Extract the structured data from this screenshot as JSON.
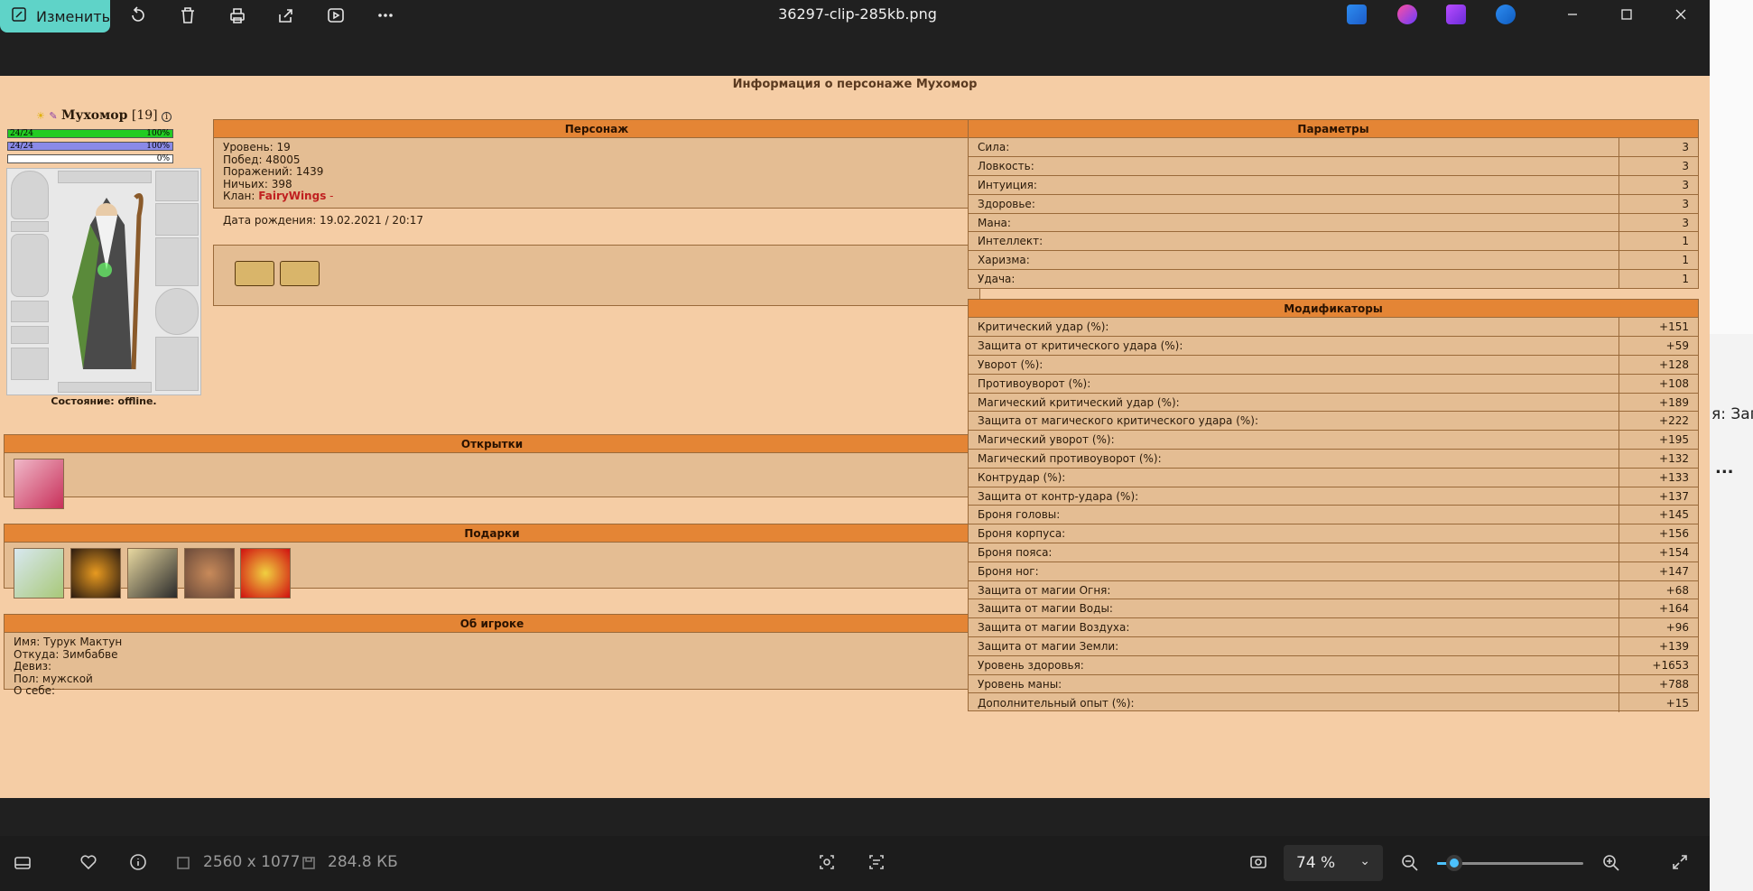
{
  "window": {
    "edit_label": "Изменить",
    "filename": "36297-clip-285kb.png"
  },
  "side": {
    "partial_text": "я: Загр",
    "dots": "..."
  },
  "page": {
    "title": "Информация о персонаже Мухомор",
    "character": {
      "name": "Мухомор",
      "level_tag": "[19]",
      "hp_bar": {
        "left": "24/24",
        "right": "100%",
        "fraction": 1.0,
        "color": "#22cc22"
      },
      "mana_bar": {
        "left": "24/24",
        "right": "100%",
        "fraction": 1.0,
        "color": "#8a8ae8"
      },
      "exp_bar": {
        "right": "0%",
        "fraction": 0.0
      },
      "status": "Состояние: offline."
    },
    "personage": {
      "header": "Персонаж",
      "level": "Уровень: 19",
      "wins": "Побед: 48005",
      "losses": "Поражений: 1439",
      "draws": "Ничьих: 398",
      "clan_label": "Клан:",
      "clan_name": "FairyWings",
      "clan_suffix": "-",
      "birth": "Дата рождения: 19.02.2021 / 20:17"
    },
    "cards": {
      "header": "Открытки"
    },
    "gifts": {
      "header": "Подарки"
    },
    "about": {
      "header": "Об игроке",
      "lines": [
        "Имя: Турук Мактун",
        "Откуда: Зимбабве",
        "Девиз:",
        "Пол: мужской",
        "О себе:"
      ]
    },
    "params": {
      "header": "Параметры",
      "rows": [
        [
          "Сила:",
          "3"
        ],
        [
          "Ловкость:",
          "3"
        ],
        [
          "Интуиция:",
          "3"
        ],
        [
          "Здоровье:",
          "3"
        ],
        [
          "Мана:",
          "3"
        ],
        [
          "Интеллект:",
          "1"
        ],
        [
          "Харизма:",
          "1"
        ],
        [
          "Удача:",
          "1"
        ]
      ]
    },
    "modifiers": {
      "header": "Модификаторы",
      "rows": [
        [
          "Критический удар (%):",
          "+151"
        ],
        [
          "Защита от критического удара (%):",
          "+59"
        ],
        [
          "Уворот (%):",
          "+128"
        ],
        [
          "Противоуворот (%):",
          "+108"
        ],
        [
          "Магический критический удар (%):",
          "+189"
        ],
        [
          "Защита от магического критического удара (%):",
          "+222"
        ],
        [
          "Магический уворот (%):",
          "+195"
        ],
        [
          "Магический противоуворот (%):",
          "+132"
        ],
        [
          "Контрудар (%):",
          "+133"
        ],
        [
          "Защита от контр-удара (%):",
          "+137"
        ],
        [
          "Броня головы:",
          "+145"
        ],
        [
          "Броня корпуса:",
          "+156"
        ],
        [
          "Броня пояса:",
          "+154"
        ],
        [
          "Броня ног:",
          "+147"
        ],
        [
          "Защита от магии Огня:",
          "+68"
        ],
        [
          "Защита от магии Воды:",
          "+164"
        ],
        [
          "Защита от магии Воздуха:",
          "+96"
        ],
        [
          "Защита от магии Земли:",
          "+139"
        ],
        [
          "Уровень здоровья:",
          "+1653"
        ],
        [
          "Уровень маны:",
          "+788"
        ],
        [
          "Дополнительный опыт (%):",
          "+15"
        ]
      ]
    }
  },
  "statusbar": {
    "dimensions": "2560 x 1077",
    "filesize": "284.8 КБ",
    "zoom": "74 %",
    "zoom_fraction": 0.12
  }
}
